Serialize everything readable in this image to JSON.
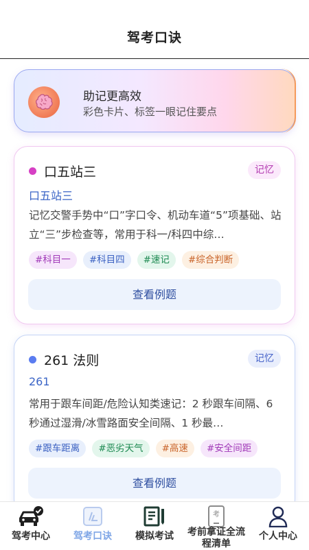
{
  "header": {
    "title": "驾考口诀"
  },
  "banner": {
    "title": "助记更高效",
    "subtitle": "彩色卡片、标签一眼记住要点"
  },
  "cards": [
    {
      "name": "口五站三",
      "badge": "记忆",
      "subtitle": "口五站三",
      "description": "记忆交警手势中“口”字口令、机动车道“5”项基础、站立“三”步检查等，常用于科一/科四中综…",
      "tags": [
        "#科目一",
        "#科目四",
        "#速记",
        "#综合判断"
      ],
      "button": "查看例题"
    },
    {
      "name": "261 法则",
      "badge": "记忆",
      "subtitle": "261",
      "description": "常用于跟车间距/危险认知类速记：2 秒跟车间隔、6 秒通过湿滑/冰雪路面安全间隔、1 秒最…",
      "tags": [
        "#跟车距离",
        "#恶劣天气",
        "#高速",
        "#安全间距"
      ],
      "button": "查看例题"
    }
  ],
  "nav": [
    {
      "label": "驾考中心",
      "icon": "car-check-icon"
    },
    {
      "label": "驾考口诀",
      "icon": "note-pen-icon",
      "active": true
    },
    {
      "label": "模拟考试",
      "icon": "book-pen-icon"
    },
    {
      "label": "考前拿证全流程清单",
      "icon": "exam-phone-icon"
    },
    {
      "label": "个人中心",
      "icon": "person-icon"
    }
  ],
  "colors": {
    "accent": "#7fa6e6",
    "card1_border": "#f0c8f0",
    "card2_border": "#c5d4f5"
  }
}
